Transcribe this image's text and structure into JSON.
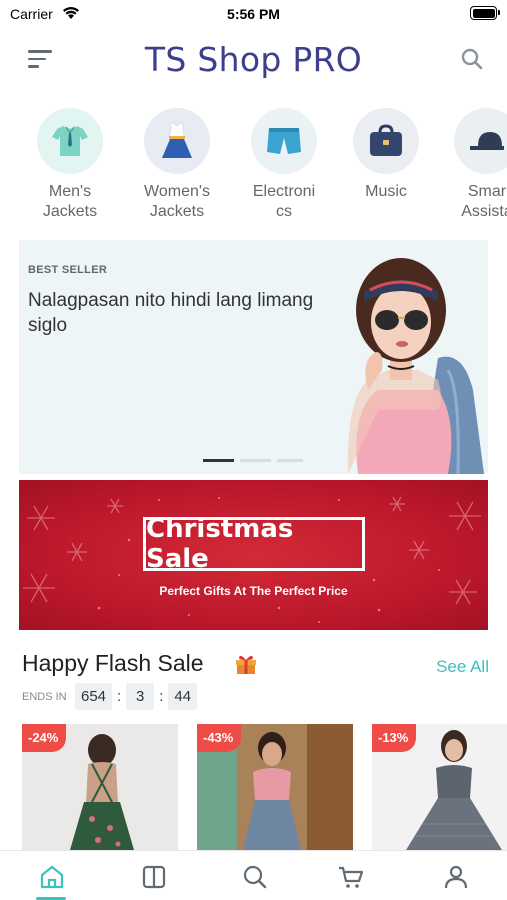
{
  "status_bar": {
    "carrier": "Carrier",
    "time": "5:56 PM"
  },
  "header": {
    "title": "TS Shop PRO",
    "menu_icon": "hamburger-icon",
    "search_icon": "search-icon"
  },
  "categories": [
    {
      "label": "Men's\nJackets",
      "icon": "shirt-icon",
      "bg": "#e3f5f2"
    },
    {
      "label": "Women's\nJackets",
      "icon": "dress-icon",
      "bg": "#e7ebf3"
    },
    {
      "label": "Electroni\ncs",
      "icon": "shorts-icon",
      "bg": "#eaf2f6"
    },
    {
      "label": "Music",
      "icon": "bag-icon",
      "bg": "#eaedf1"
    },
    {
      "label": "Smar\nAssista",
      "icon": "cap-icon",
      "bg": "#eceff2"
    }
  ],
  "hero": {
    "tag": "BEST SELLER",
    "title": "Nalagpasan nito hindi lang limang siglo",
    "dots": 3,
    "active_dot": 0
  },
  "christmas_banner": {
    "title": "Christmas Sale",
    "subtitle": "Perfect Gifts At The Perfect Price"
  },
  "flash_sale": {
    "title": "Happy Flash Sale",
    "see_all": "See All",
    "ends_label": "ENDS IN",
    "timer": [
      "654",
      "3",
      "44"
    ],
    "products": [
      {
        "discount": "-24%"
      },
      {
        "discount": "-43%"
      },
      {
        "discount": "-13%"
      }
    ]
  },
  "tabbar": {
    "items": [
      "home-icon",
      "catalog-icon",
      "search-icon",
      "cart-icon",
      "profile-icon"
    ],
    "active": 0,
    "accent": "#3fbfbf"
  },
  "colors": {
    "title": "#3d3f8c",
    "accent": "#3fbfbf",
    "discount": "#ef4c48",
    "banner_red": "#c11d2f"
  }
}
